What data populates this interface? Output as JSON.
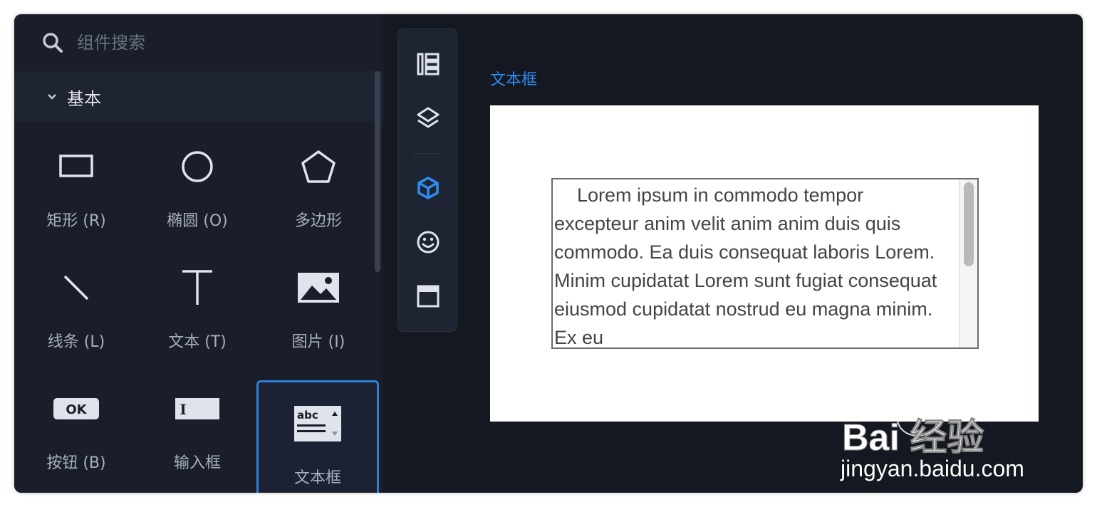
{
  "search": {
    "placeholder": "组件搜索"
  },
  "section": {
    "title": "基本"
  },
  "components": [
    {
      "label": "矩形 (R)",
      "icon": "rectangle-icon"
    },
    {
      "label": "椭圆 (O)",
      "icon": "ellipse-icon"
    },
    {
      "label": "多边形",
      "icon": "polygon-icon"
    },
    {
      "label": "线条 (L)",
      "icon": "line-icon"
    },
    {
      "label": "文本 (T)",
      "icon": "text-icon"
    },
    {
      "label": "图片 (I)",
      "icon": "image-icon"
    },
    {
      "label": "按钮 (B)",
      "icon": "button-icon",
      "icon_text": "OK"
    },
    {
      "label": "输入框",
      "icon": "input-icon"
    },
    {
      "label": "文本框",
      "icon": "textarea-icon",
      "icon_text": "abc",
      "selected": true
    }
  ],
  "toolbar": [
    {
      "icon": "outline-tree-icon"
    },
    {
      "icon": "layers-icon"
    },
    {
      "icon": "components-cube-icon",
      "active": true
    },
    {
      "icon": "smiley-icon"
    },
    {
      "icon": "master-panel-icon"
    }
  ],
  "canvas": {
    "title": "文本框",
    "textarea_value": "Lorem ipsum in commodo tempor excepteur anim velit anim anim duis quis commodo. Ea duis consequat laboris Lorem. Minim cupidatat Lorem sunt fugiat consequat eiusmod cupidatat nostrud eu magna minim. Ex eu"
  },
  "watermark": {
    "brand": "Bai 经验",
    "url": "jingyan.baidu.com"
  },
  "colors": {
    "accent": "#2f8ef5",
    "panel": "#191e2a",
    "background": "#141821",
    "icon_light": "#dfe3ec"
  }
}
